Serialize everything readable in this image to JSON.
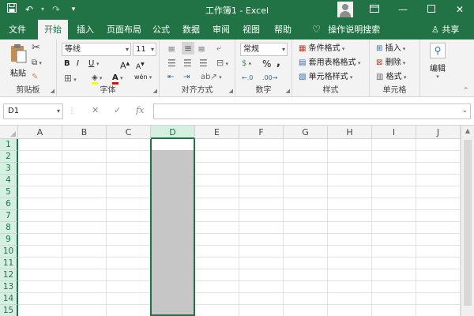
{
  "titlebar": {
    "title": "工作簿1 - Excel",
    "qat_icons": [
      "save-icon",
      "undo-icon",
      "redo-icon",
      "customize-qat-icon"
    ],
    "accent": "#217346"
  },
  "tabs": [
    {
      "label": "文件",
      "active": false
    },
    {
      "label": "开始",
      "active": true
    },
    {
      "label": "插入",
      "active": false
    },
    {
      "label": "页面布局",
      "active": false
    },
    {
      "label": "公式",
      "active": false
    },
    {
      "label": "数据",
      "active": false
    },
    {
      "label": "审阅",
      "active": false
    },
    {
      "label": "视图",
      "active": false
    },
    {
      "label": "帮助",
      "active": false
    }
  ],
  "tellme": "操作说明搜索",
  "share": "共享",
  "ribbon": {
    "clipboard": {
      "label": "剪贴板",
      "paste": "粘贴"
    },
    "font": {
      "label": "字体",
      "font_name": "等线",
      "font_size": "11",
      "bold": "B",
      "italic": "I",
      "underline": "U",
      "grow": "A",
      "shrink": "A",
      "font_color": "A",
      "phonetic": "wén"
    },
    "alignment": {
      "label": "对齐方式"
    },
    "number": {
      "label": "数字",
      "format": "常规",
      "percent": "%",
      "comma": ","
    },
    "styles": {
      "label": "样式",
      "conditional": "条件格式",
      "table": "套用表格格式",
      "cell": "单元格样式"
    },
    "cells": {
      "label": "单元格",
      "insert": "插入",
      "delete": "删除",
      "format": "格式"
    },
    "editing": {
      "label": "编辑"
    }
  },
  "formula_bar": {
    "name_box": "D1",
    "fx": "fx",
    "cancel": "✕",
    "enter": "✓",
    "value": ""
  },
  "grid": {
    "columns": [
      "A",
      "B",
      "C",
      "D",
      "E",
      "F",
      "G",
      "H",
      "I",
      "J"
    ],
    "rows": [
      "1",
      "2",
      "3",
      "4",
      "5",
      "6",
      "7",
      "8",
      "9",
      "10",
      "11",
      "12",
      "13",
      "14",
      "15"
    ],
    "selected_column": "D",
    "active_cell": "D1"
  }
}
